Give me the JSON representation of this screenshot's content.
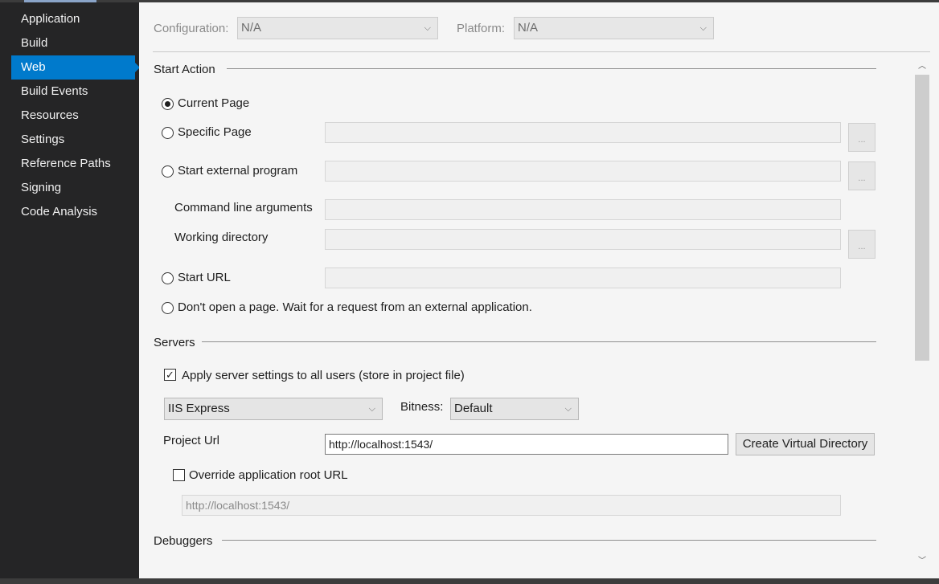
{
  "sidebar": {
    "items": [
      {
        "label": "Application",
        "active": false
      },
      {
        "label": "Build",
        "active": false
      },
      {
        "label": "Web",
        "active": true
      },
      {
        "label": "Build Events",
        "active": false
      },
      {
        "label": "Resources",
        "active": false
      },
      {
        "label": "Settings",
        "active": false
      },
      {
        "label": "Reference Paths",
        "active": false
      },
      {
        "label": "Signing",
        "active": false
      },
      {
        "label": "Code Analysis",
        "active": false
      }
    ]
  },
  "header": {
    "configuration_label": "Configuration:",
    "configuration_value": "N/A",
    "platform_label": "Platform:",
    "platform_value": "N/A"
  },
  "start_action": {
    "title": "Start Action",
    "current_page": "Current Page",
    "specific_page": "Specific Page",
    "start_external_program": "Start external program",
    "command_line_arguments": "Command line arguments",
    "working_directory": "Working directory",
    "start_url": "Start URL",
    "dont_open": "Don't open a page.  Wait for a request from an external application.",
    "browse_label": "...",
    "selected": "current_page"
  },
  "servers": {
    "title": "Servers",
    "apply_settings": "Apply server settings to all users (store in project file)",
    "apply_checked": true,
    "server_value": "IIS Express",
    "bitness_label": "Bitness:",
    "bitness_value": "Default",
    "project_url_label": "Project Url",
    "project_url_value": "http://localhost:1543/",
    "create_vdir": "Create Virtual Directory",
    "override_label": "Override application root URL",
    "override_checked": false,
    "override_value": "http://localhost:1543/"
  },
  "debuggers": {
    "title": "Debuggers"
  },
  "icons": {
    "chevron": "⌵",
    "check": "✓",
    "scroll_up": "︿",
    "scroll_down": "﹀"
  }
}
